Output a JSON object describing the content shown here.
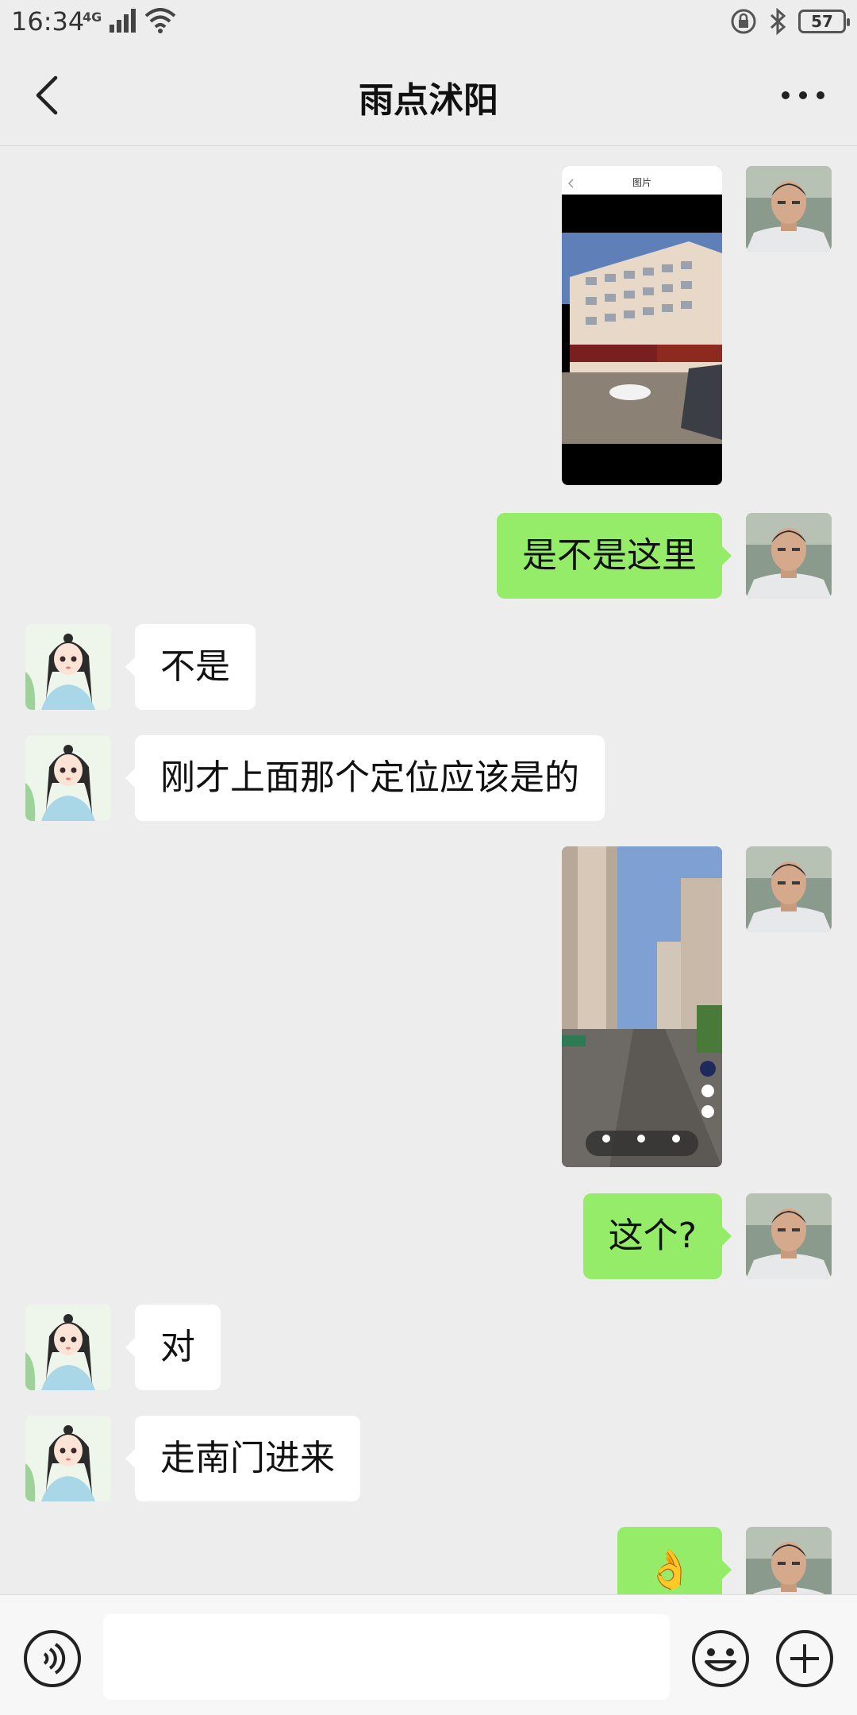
{
  "status_bar": {
    "time": "16:34",
    "network": "4G",
    "battery": "57"
  },
  "header": {
    "title": "雨点沭阳"
  },
  "messages": {
    "m2": "是不是这里",
    "m3": "不是",
    "m4": "刚才上面那个定位应该是的",
    "m6": "这个?",
    "m7": "对",
    "m8": "走南门进来",
    "m9": "👌"
  },
  "image1": {
    "header_title": "图片"
  },
  "input": {
    "placeholder": ""
  },
  "colors": {
    "background": "#ededed",
    "my_bubble": "#95ec69",
    "their_bubble": "#ffffff"
  }
}
